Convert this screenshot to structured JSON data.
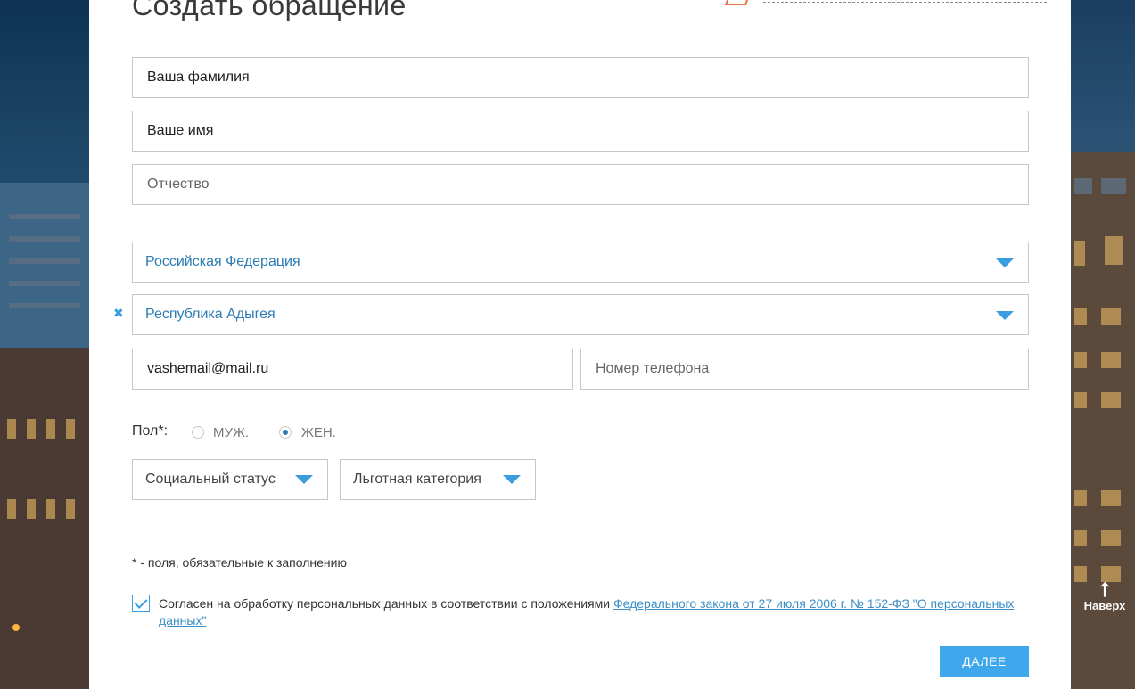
{
  "form": {
    "title": "Создать обращение",
    "last_name_placeholder": "Ваша фамилия",
    "first_name_placeholder": "Ваше имя",
    "patronymic_placeholder": "Отчество",
    "country_value": "Российская Федерация",
    "region_value": "Республика Адыгея",
    "email_value": "vashemail@mail.ru",
    "phone_placeholder": "Номер телефона",
    "gender": {
      "label": "Пол*:",
      "options": [
        "МУЖ.",
        "ЖЕН."
      ],
      "selected": "ЖЕН."
    },
    "social_status_label": "Социальный статус",
    "benefit_category_label": "Льготная категория",
    "required_note": "* - поля, обязательные к заполнению",
    "consent": {
      "checked": true,
      "text": "Согласен на обработку персональных данных в соответствии с положениями ",
      "link_text": "Федерального закона от 27 июля 2006 г. № 152-ФЗ \"О персональных данных\""
    },
    "next_button": "ДАЛЕЕ"
  },
  "page": {
    "to_top_label": "Наверх"
  },
  "icons": {
    "clear": "close-icon",
    "dropdown": "triangle-down-icon",
    "to_top": "arrow-up-icon",
    "checkbox_tick": "checkmark-icon"
  },
  "colors": {
    "accent": "#3fa7ec",
    "select_text": "#2a7cb3",
    "link": "#3b8fc6"
  }
}
